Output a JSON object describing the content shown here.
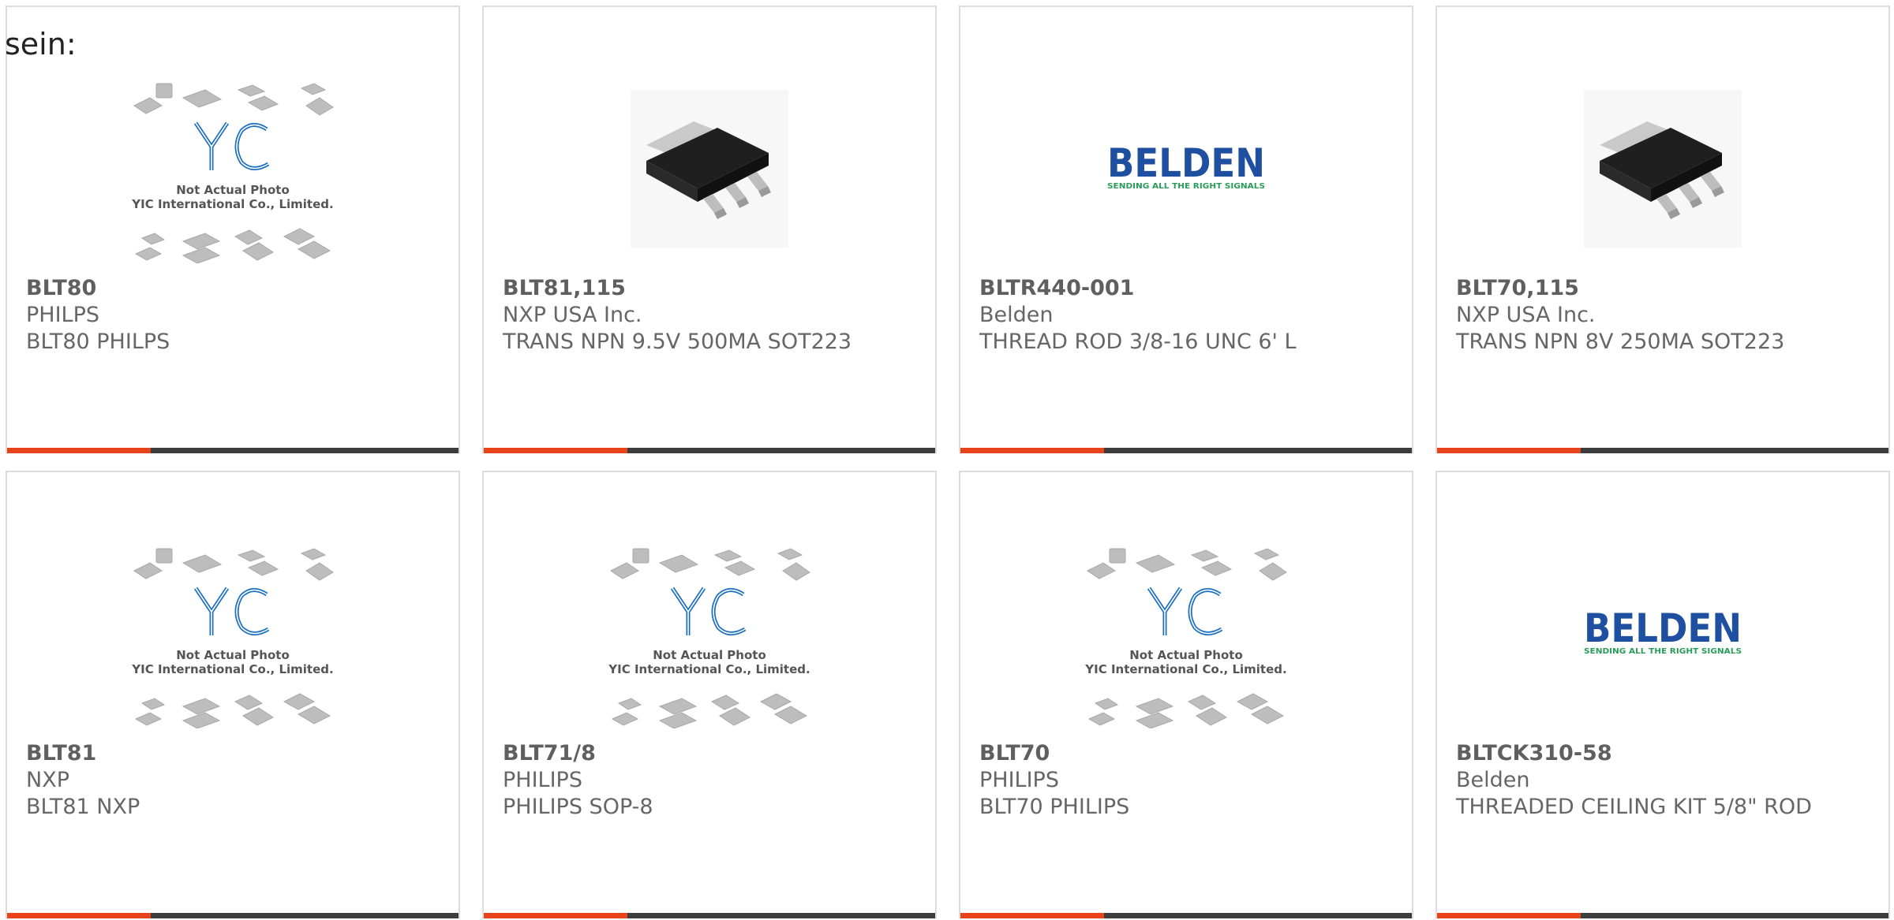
{
  "intro_text": "sein:",
  "placeholder": {
    "line1": "Not Actual Photo",
    "line2": "YIC International Co., Limited.",
    "logo": "YIC"
  },
  "belden_logo": {
    "word": "BELDEN",
    "tagline": "SENDING ALL THE RIGHT SIGNALS",
    "color": "#1e4fa0",
    "tagline_color": "#2a9d5a"
  },
  "accent_color": "#e8431a",
  "bar_color": "#3d3d3d",
  "products": [
    {
      "part": "BLT80",
      "maker": "PHILPS",
      "desc": "BLT80 PHILPS",
      "image": "placeholder"
    },
    {
      "part": "BLT81,115",
      "maker": "NXP USA Inc.",
      "desc": "TRANS NPN 9.5V 500MA SOT223",
      "image": "sot223-transistor"
    },
    {
      "part": "BLTR440-001",
      "maker": "Belden",
      "desc": "THREAD ROD 3/8-16 UNC 6' L",
      "image": "belden-logo"
    },
    {
      "part": "BLT70,115",
      "maker": "NXP USA Inc.",
      "desc": "TRANS NPN 8V 250MA SOT223",
      "image": "sot223-transistor"
    },
    {
      "part": "BLT81",
      "maker": "NXP",
      "desc": "BLT81 NXP",
      "image": "placeholder"
    },
    {
      "part": "BLT71/8",
      "maker": "PHILIPS",
      "desc": "PHILIPS SOP-8",
      "image": "placeholder"
    },
    {
      "part": "BLT70",
      "maker": "PHILIPS",
      "desc": "BLT70 PHILIPS",
      "image": "placeholder"
    },
    {
      "part": "BLTCK310-58",
      "maker": "Belden",
      "desc": "THREADED CEILING KIT 5/8\" ROD",
      "image": "belden-logo"
    }
  ]
}
